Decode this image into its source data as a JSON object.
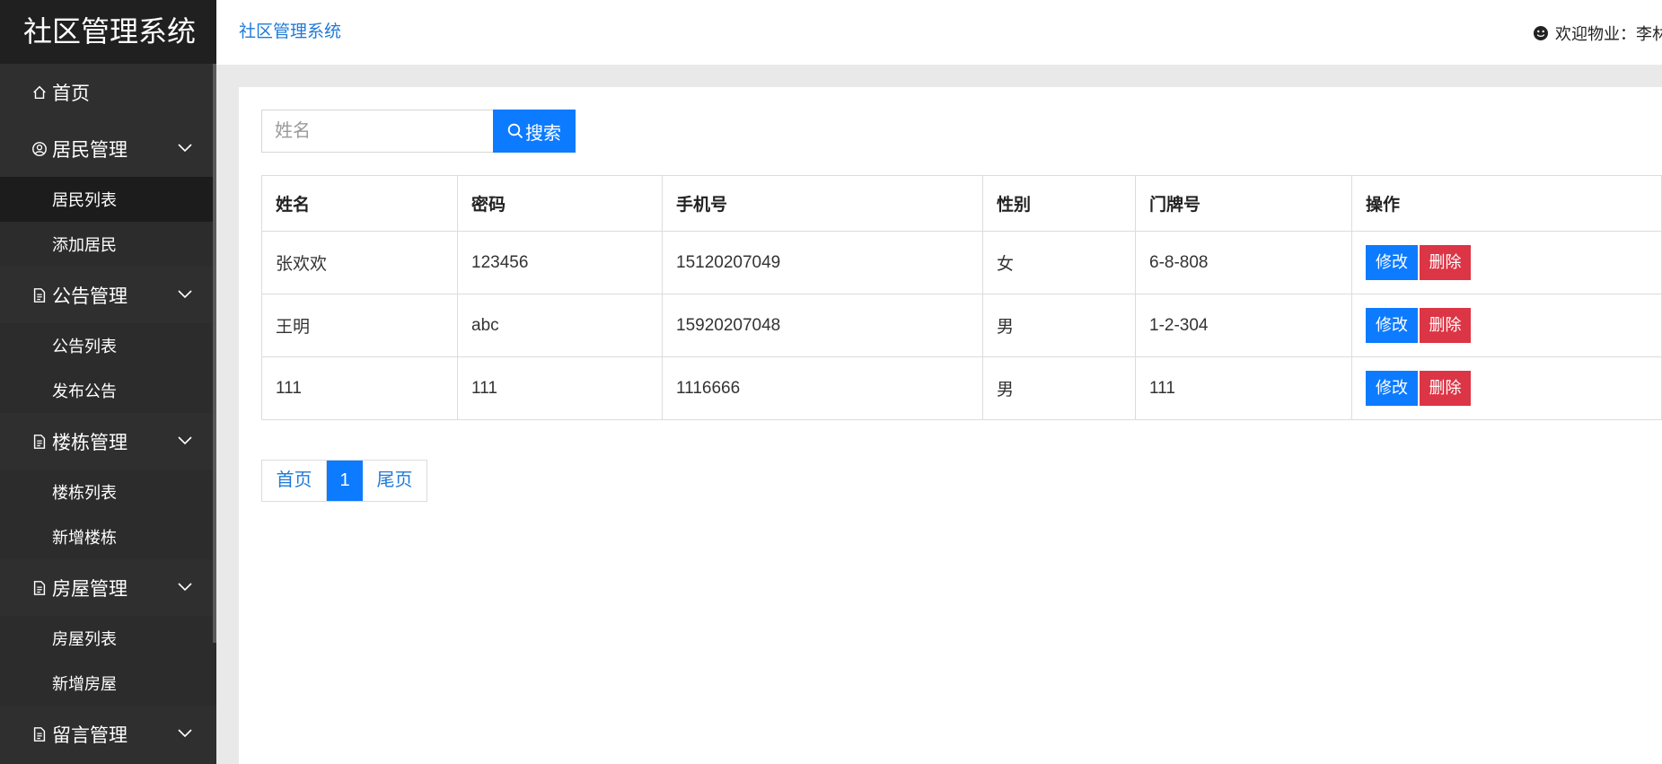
{
  "sidebar": {
    "brand": "社区管理系统",
    "home": "首页",
    "groups": [
      {
        "label": "居民管理",
        "items": [
          "居民列表",
          "添加居民"
        ]
      },
      {
        "label": "公告管理",
        "items": [
          "公告列表",
          "发布公告"
        ]
      },
      {
        "label": "楼栋管理",
        "items": [
          "楼栋列表",
          "新增楼栋"
        ]
      },
      {
        "label": "房屋管理",
        "items": [
          "房屋列表",
          "新增房屋"
        ]
      },
      {
        "label": "留言管理",
        "items": []
      }
    ],
    "active_item": "居民列表"
  },
  "topbar": {
    "title": "社区管理系统",
    "welcome": "欢迎物业：李林"
  },
  "search": {
    "placeholder": "姓名",
    "value": "",
    "button_label": "搜索"
  },
  "table": {
    "headers": [
      "姓名",
      "密码",
      "手机号",
      "性别",
      "门牌号",
      "操作"
    ],
    "rows": [
      {
        "name": "张欢欢",
        "password": "123456",
        "phone": "15120207049",
        "gender": "女",
        "door": "6-8-808"
      },
      {
        "name": "王明",
        "password": "abc",
        "phone": "15920207048",
        "gender": "男",
        "door": "1-2-304"
      },
      {
        "name": "111",
        "password": "111",
        "phone": "1116666",
        "gender": "男",
        "door": "111"
      }
    ],
    "edit_label": "修改",
    "delete_label": "删除"
  },
  "pagination": {
    "first": "首页",
    "current": "1",
    "last": "尾页"
  },
  "colors": {
    "primary": "#0d7bff",
    "danger": "#dc3545",
    "sidebar_bg": "#2f2f2f",
    "brand_bg": "#202020",
    "link": "#1e7ad8"
  }
}
